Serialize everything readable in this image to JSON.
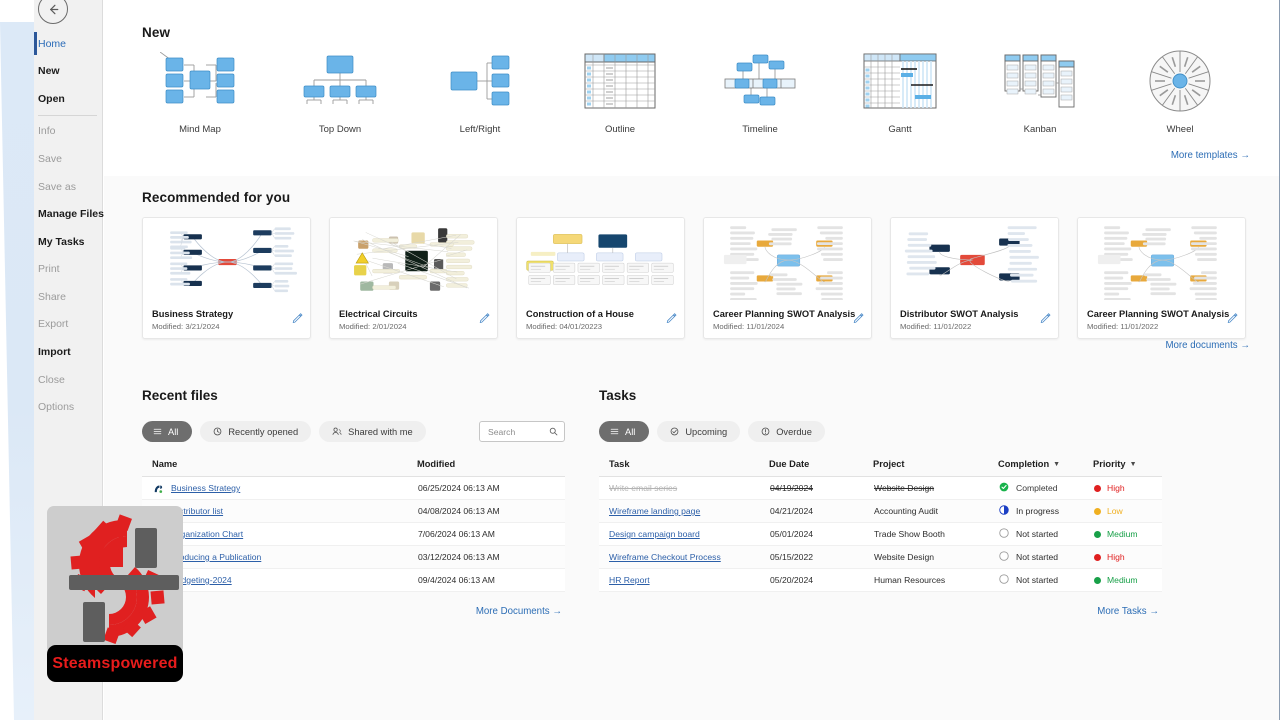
{
  "window": {
    "back_button": "back-arrow"
  },
  "sidebar": {
    "items": [
      {
        "label": "Home",
        "state": "active"
      },
      {
        "label": "New",
        "state": "bold"
      },
      {
        "label": "Open",
        "state": "bold"
      },
      {
        "label": "Info",
        "state": "dim"
      },
      {
        "label": "Save",
        "state": "dim"
      },
      {
        "label": "Save as",
        "state": "dim"
      },
      {
        "label": "Manage Files",
        "state": "bold"
      },
      {
        "label": "My Tasks",
        "state": "bold"
      },
      {
        "label": "Print",
        "state": "dim"
      },
      {
        "label": "Share",
        "state": "dim"
      },
      {
        "label": "Export",
        "state": "dim"
      },
      {
        "label": "Import",
        "state": "bold"
      },
      {
        "label": "Close",
        "state": "dim"
      },
      {
        "label": "Options",
        "state": "dim"
      }
    ]
  },
  "new_section": {
    "title": "New",
    "more_link": "More templates",
    "templates": [
      {
        "label": "Mind Map",
        "icon": "mind-map-template-icon"
      },
      {
        "label": "Top Down",
        "icon": "top-down-template-icon"
      },
      {
        "label": "Left/Right",
        "icon": "left-right-template-icon"
      },
      {
        "label": "Outline",
        "icon": "outline-template-icon"
      },
      {
        "label": "Timeline",
        "icon": "timeline-template-icon"
      },
      {
        "label": "Gantt",
        "icon": "gantt-template-icon"
      },
      {
        "label": "Kanban",
        "icon": "kanban-template-icon"
      },
      {
        "label": "Wheel",
        "icon": "wheel-template-icon"
      }
    ]
  },
  "recommended": {
    "title": "Recommended for you",
    "more_link": "More documents",
    "cards": [
      {
        "name": "Business Strategy",
        "modified": "Modified: 3/21/2024",
        "thumb": "mindmap-blue"
      },
      {
        "name": "Electrical Circuits",
        "modified": "Modified: 2/01/2024",
        "thumb": "mindmap-photo"
      },
      {
        "name": "Construction of a House",
        "modified": "Modified: 04/01/20223",
        "thumb": "orgchart-navy"
      },
      {
        "name": "Career Planning SWOT Analysis",
        "modified": "Modified: 11/01/2024",
        "thumb": "swot-amber"
      },
      {
        "name": "Distributor SWOT Analysis",
        "modified": "Modified: 11/01/2022",
        "thumb": "swot-navy"
      },
      {
        "name": "Career Planning SWOT Analysis",
        "modified": "Modified: 11/01/2022",
        "thumb": "swot-amber"
      }
    ]
  },
  "recent_files": {
    "title": "Recent files",
    "filters": [
      {
        "label": "All",
        "icon": "list-icon",
        "selected": true
      },
      {
        "label": "Recently opened",
        "icon": "clock-icon",
        "selected": false
      },
      {
        "label": "Shared with me",
        "icon": "people-icon",
        "selected": false
      }
    ],
    "search": {
      "placeholder": "Search",
      "value": "",
      "icon": "search-icon"
    },
    "columns": [
      "Name",
      "Modified"
    ],
    "rows": [
      {
        "name": "Business Strategy",
        "modified": "06/25/2024 06:13 AM"
      },
      {
        "name": "Distributor list",
        "modified": "04/08/2024 06:13 AM"
      },
      {
        "name": "Organization Chart",
        "modified": "7/06/2024 06:13 AM"
      },
      {
        "name": "Producing a Publication",
        "modified": "03/12/2024 06:13 AM"
      },
      {
        "name": "Budgeting-2024",
        "modified": "09/4/2024 06:13 AM"
      }
    ],
    "more_link": "More Documents"
  },
  "tasks": {
    "title": "Tasks",
    "filters": [
      {
        "label": "All",
        "icon": "list-icon",
        "selected": true
      },
      {
        "label": "Upcoming",
        "icon": "upcoming-icon",
        "selected": false
      },
      {
        "label": "Overdue",
        "icon": "overdue-icon",
        "selected": false
      }
    ],
    "columns": [
      "Task",
      "Due Date",
      "Project",
      "Completion",
      "Priority"
    ],
    "rows": [
      {
        "task": "Write email series",
        "due": "04/19/2024",
        "project": "Website Design",
        "completion": "Completed",
        "priority": "High",
        "done": true
      },
      {
        "task": "Wireframe landing page",
        "due": "04/21/2024",
        "project": "Accounting Audit",
        "completion": "In progress",
        "priority": "Low",
        "done": false
      },
      {
        "task": "Design campaign board",
        "due": "05/01/2024",
        "project": "Trade Show Booth",
        "completion": "Not started",
        "priority": "Medium",
        "done": false
      },
      {
        "task": "Wireframe Checkout Process",
        "due": "05/15/2022",
        "project": "Website Design",
        "completion": "Not started",
        "priority": "High",
        "done": false
      },
      {
        "task": "HR Report",
        "due": "05/20/2024",
        "project": "Human Resources",
        "completion": "Not started",
        "priority": "Medium",
        "done": false
      }
    ],
    "more_link": "More Tasks"
  },
  "watermark": {
    "text": "Steamspowered",
    "icon": "gear-logo-icon"
  },
  "colors": {
    "accent_blue": "#2c6db5",
    "template_blue": "#6ab4e8",
    "pill_selected": "#6e6e6e",
    "priority_high": "#e02020",
    "priority_low": "#f0b021",
    "priority_medium": "#18a048",
    "status_completed": "#1db954",
    "status_inprogress": "#1c4fd8",
    "watermark_red": "#e81c1c"
  }
}
